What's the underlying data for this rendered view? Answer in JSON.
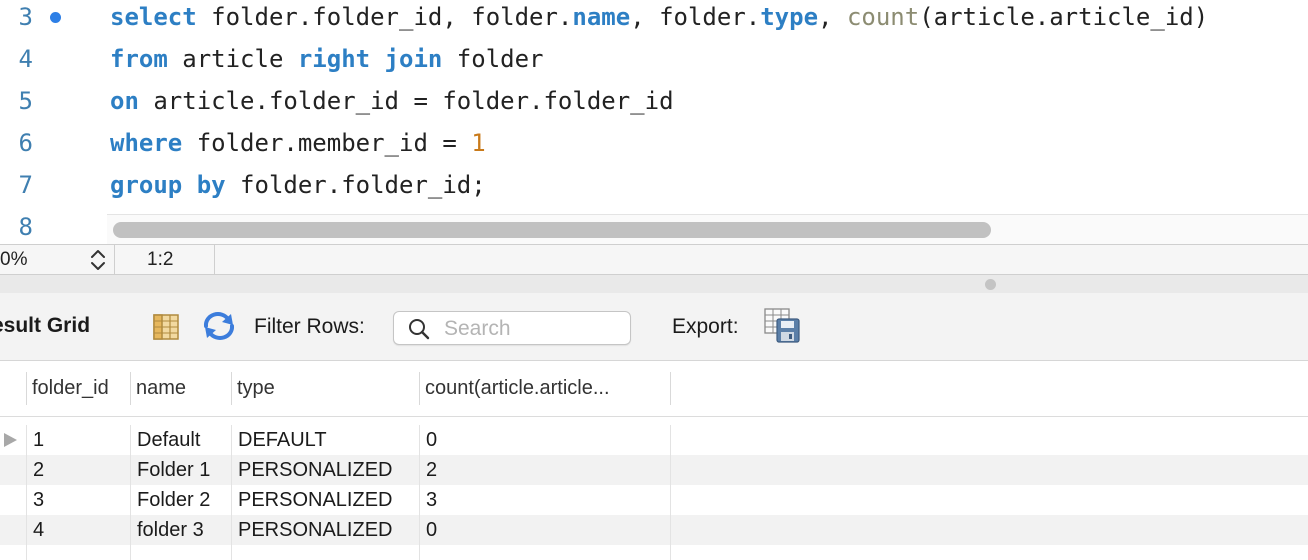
{
  "editor": {
    "line_numbers": [
      "3",
      "4",
      "5",
      "6",
      "7",
      "8"
    ],
    "lines": [
      [
        {
          "t": "select",
          "c": "kw"
        },
        {
          "t": " folder.folder_id, folder.",
          "c": ""
        },
        {
          "t": "name",
          "c": "kw"
        },
        {
          "t": ", folder.",
          "c": ""
        },
        {
          "t": "type",
          "c": "kw"
        },
        {
          "t": ", ",
          "c": ""
        },
        {
          "t": "count",
          "c": "fn"
        },
        {
          "t": "(article.article_id)",
          "c": ""
        }
      ],
      [
        {
          "t": "from",
          "c": "kw"
        },
        {
          "t": " article ",
          "c": ""
        },
        {
          "t": "right",
          "c": "kw"
        },
        {
          "t": " ",
          "c": ""
        },
        {
          "t": "join",
          "c": "kw"
        },
        {
          "t": " folder",
          "c": ""
        }
      ],
      [
        {
          "t": "on",
          "c": "kw"
        },
        {
          "t": " article.folder_id = folder.folder_id",
          "c": ""
        }
      ],
      [
        {
          "t": "where",
          "c": "kw"
        },
        {
          "t": " folder.member_id = ",
          "c": ""
        },
        {
          "t": "1",
          "c": "num"
        }
      ],
      [
        {
          "t": "group",
          "c": "kw"
        },
        {
          "t": " ",
          "c": ""
        },
        {
          "t": "by",
          "c": "kw"
        },
        {
          "t": " folder.folder_id;",
          "c": ""
        }
      ],
      []
    ]
  },
  "status": {
    "zoom": "0%",
    "cursor_position": "1:2"
  },
  "toolbar": {
    "title": "esult Grid",
    "filter_label": "Filter Rows:",
    "search_placeholder": "Search",
    "export_label": "Export:"
  },
  "grid": {
    "columns": [
      "folder_id",
      "name",
      "type",
      "count(article.article..."
    ],
    "rows": [
      [
        "1",
        "Default",
        "DEFAULT",
        "0"
      ],
      [
        "2",
        "Folder 1",
        "PERSONALIZED",
        "2"
      ],
      [
        "3",
        "Folder 2",
        "PERSONALIZED",
        "3"
      ],
      [
        "4",
        "folder 3",
        "PERSONALIZED",
        "0"
      ]
    ]
  },
  "colors": {
    "keyword": "#2d7fc4",
    "function": "#8c8c72",
    "number": "#c97a1a",
    "line_number": "#3f7fb0"
  },
  "icons": [
    "breakpoint-dot-icon",
    "stepper-icon",
    "grid-layout-icon",
    "refresh-icon",
    "search-icon",
    "export-icon",
    "row-pointer-icon"
  ]
}
